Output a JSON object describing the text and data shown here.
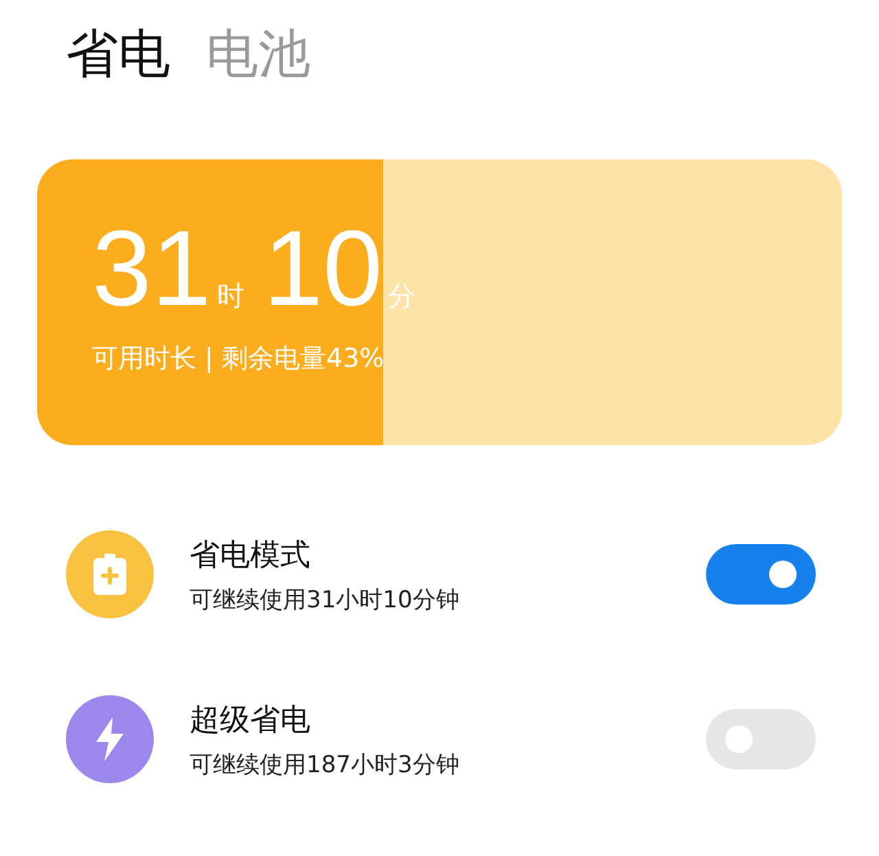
{
  "tabs": [
    {
      "label": "省电",
      "selected": true
    },
    {
      "label": "电池",
      "selected": false
    }
  ],
  "battery": {
    "level": 0.43,
    "hours": "31",
    "hours_unit": "时",
    "minutes": "10",
    "minutes_unit": "分",
    "caption": "可用时长 | 剩余电量43%"
  },
  "modes": [
    {
      "kind": "battery",
      "title": "省电模式",
      "subtitle": "可继续使用31小时10分钟",
      "on": true,
      "color": "#f8c240"
    },
    {
      "kind": "bolt",
      "title": "超级省电",
      "subtitle": "可继续使用187小时3分钟",
      "on": false,
      "color": "#9c87ec"
    }
  ]
}
